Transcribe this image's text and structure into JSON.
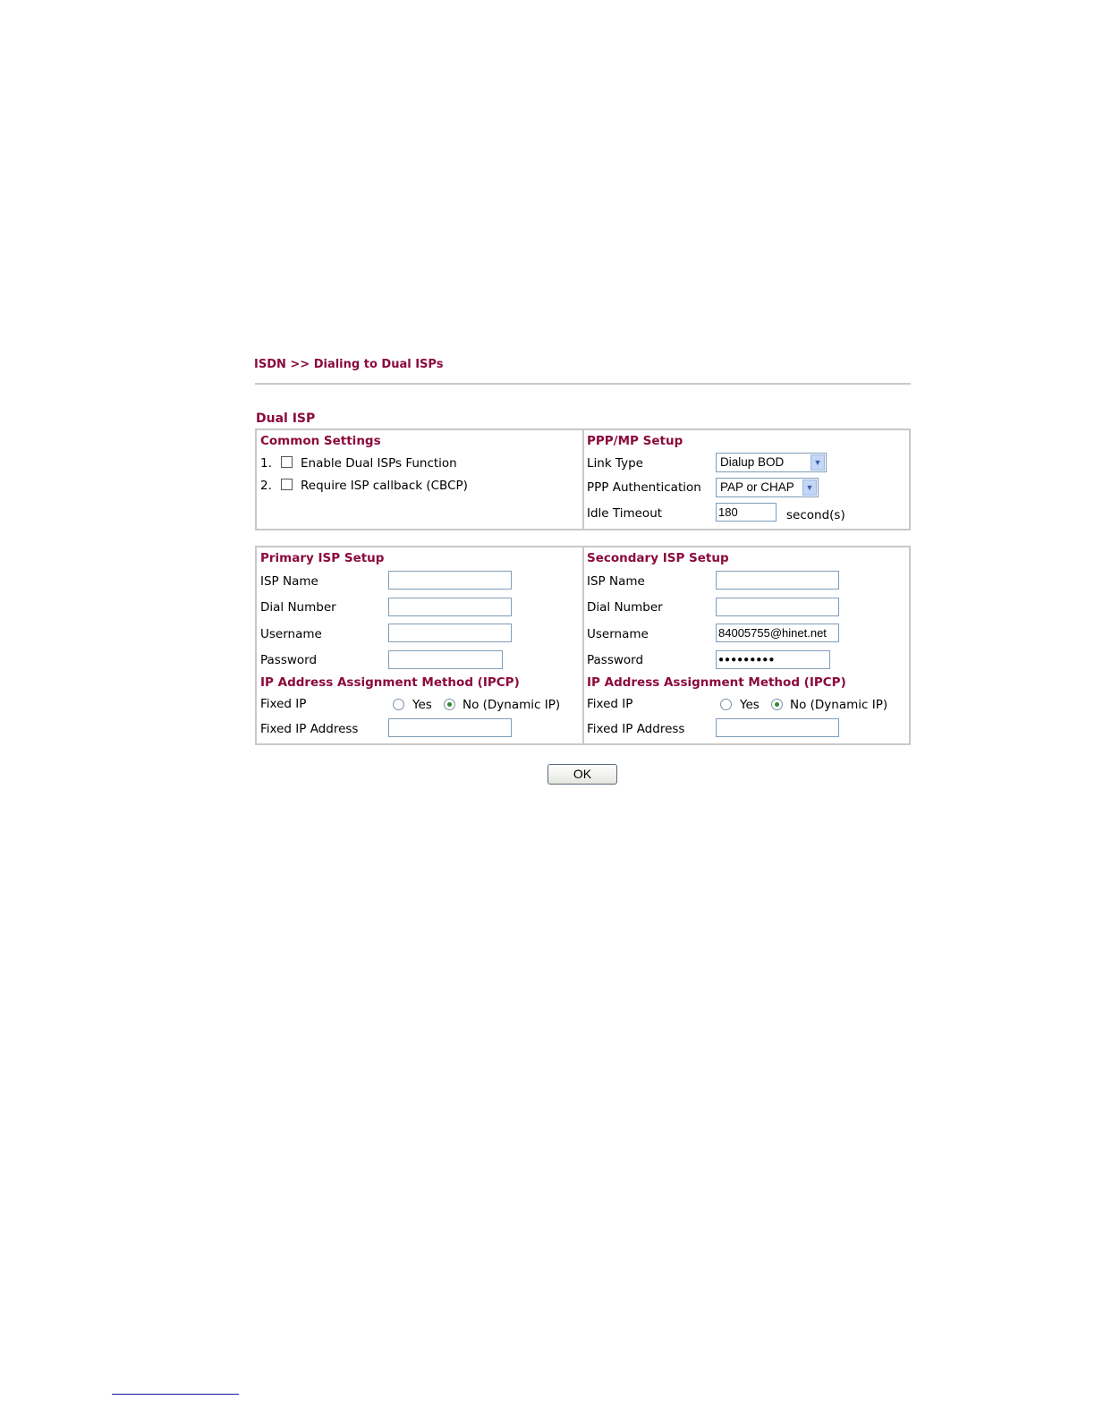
{
  "breadcrumb": "ISDN >> Dialing to Dual ISPs",
  "section_title": "Dual ISP",
  "common": {
    "title": "Common Settings",
    "items": [
      {
        "num": "1.",
        "label": "Enable Dual ISPs Function",
        "checked": false
      },
      {
        "num": "2.",
        "label": "Require ISP callback (CBCP)",
        "checked": false
      }
    ]
  },
  "ppp": {
    "title": "PPP/MP Setup",
    "link_type_label": "Link Type",
    "link_type_value": "Dialup BOD",
    "auth_label": "PPP Authentication",
    "auth_value": "PAP or CHAP",
    "idle_label": "Idle Timeout",
    "idle_value": "180",
    "idle_unit": "second(s)"
  },
  "primary": {
    "title": "Primary ISP Setup",
    "isp_name_label": "ISP Name",
    "isp_name_value": "",
    "dial_label": "Dial Number",
    "dial_value": "",
    "username_label": "Username",
    "username_value": "",
    "password_label": "Password",
    "password_value": "",
    "ipcp_title": "IP Address Assignment Method (IPCP)",
    "fixed_ip_label": "Fixed IP",
    "yes_label": "Yes",
    "no_label": "No (Dynamic IP)",
    "fixed_ip_selected": "No",
    "fixed_addr_label": "Fixed IP Address",
    "fixed_addr_value": ""
  },
  "secondary": {
    "title": "Secondary ISP Setup",
    "isp_name_label": "ISP Name",
    "isp_name_value": "",
    "dial_label": "Dial Number",
    "dial_value": "",
    "username_label": "Username",
    "username_value": "84005755@hinet.net",
    "password_label": "Password",
    "password_value": "●●●●●●●●●",
    "ipcp_title": "IP Address Assignment Method (IPCP)",
    "fixed_ip_label": "Fixed IP",
    "yes_label": "Yes",
    "no_label": "No (Dynamic IP)",
    "fixed_ip_selected": "No",
    "fixed_addr_label": "Fixed IP Address",
    "fixed_addr_value": ""
  },
  "ok_label": "OK",
  "colors": {
    "heading": "#8b0a3c",
    "border": "#c8c8c8",
    "input_border": "#7f9db9"
  }
}
